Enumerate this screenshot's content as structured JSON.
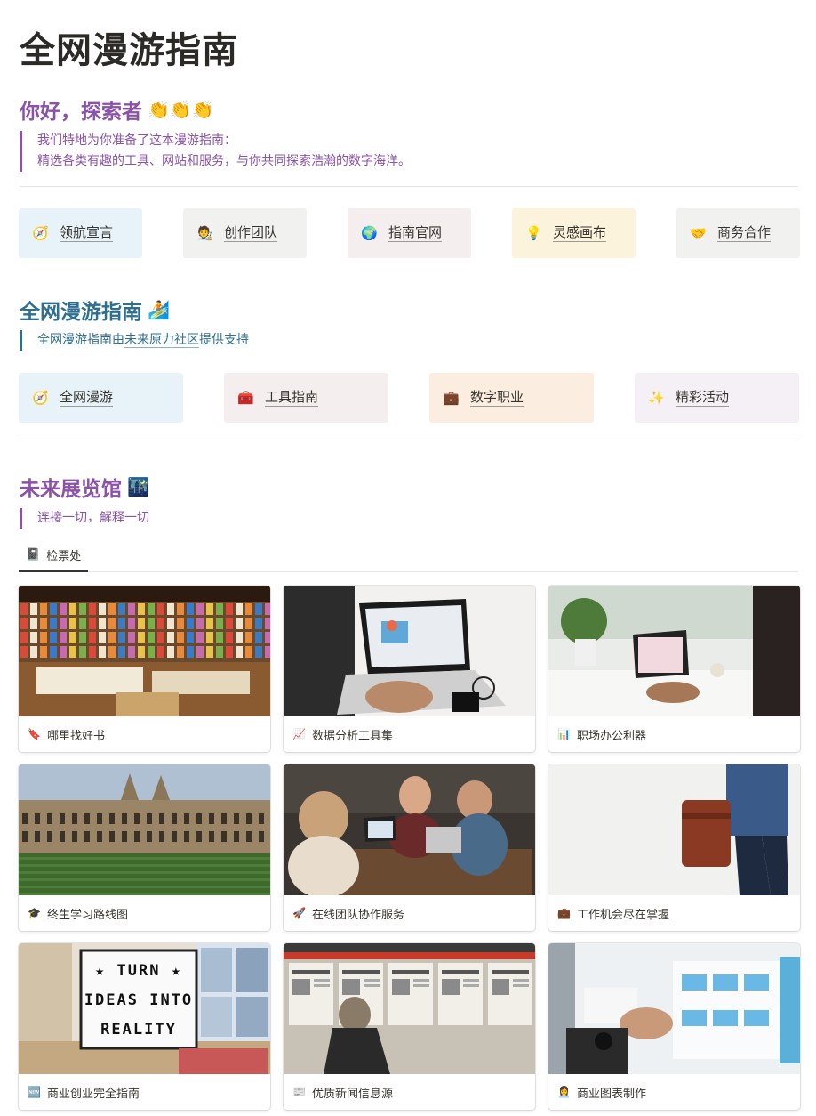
{
  "page": {
    "title": "全网漫游指南"
  },
  "intro": {
    "heading": "你好，探索者",
    "heading_emoji": "👏👏👏",
    "quote_line1": "我们特地为你准备了这本漫游指南：",
    "quote_line2": "精选各类有趣的工具、网站和服务，与你共同探索浩瀚的数字海洋。"
  },
  "nav_row1": [
    {
      "icon": "🧭",
      "label": "领航宣言",
      "bg": "bg-blue"
    },
    {
      "icon": "🧑‍🎨",
      "label": "创作团队",
      "bg": "bg-gray"
    },
    {
      "icon": "🌍",
      "label": "指南官网",
      "bg": "bg-pink"
    },
    {
      "icon": "💡",
      "label": "灵感画布",
      "bg": "bg-yellow"
    },
    {
      "icon": "🤝",
      "label": "商务合作",
      "bg": "bg-gray"
    }
  ],
  "section2": {
    "heading": "全网漫游指南",
    "heading_emoji": "🏄",
    "quote_pre": "全网漫游指南由",
    "quote_link": "未来原力社区",
    "quote_post": "提供支持"
  },
  "nav_row2": [
    {
      "icon": "🧭",
      "label": "全网漫游",
      "bg": "bg-blue"
    },
    {
      "icon": "🧰",
      "label": "工具指南",
      "bg": "bg-pink"
    },
    {
      "icon": "💼",
      "label": "数字职业",
      "bg": "bg-orange"
    },
    {
      "icon": "✨",
      "label": "精彩活动",
      "bg": "bg-purple"
    }
  ],
  "section3": {
    "heading": "未来展览馆",
    "heading_emoji": "🌃",
    "quote": "连接一切，解释一切"
  },
  "gallery_tab": {
    "icon": "📓",
    "label": "检票处"
  },
  "gallery": [
    {
      "icon": "🔖",
      "title": "哪里找好书",
      "cover": "bookstore"
    },
    {
      "icon": "📈",
      "title": "数据分析工具集",
      "cover": "laptop"
    },
    {
      "icon": "📊",
      "title": "职场办公利器",
      "cover": "office"
    },
    {
      "icon": "🎓",
      "title": "终生学习路线图",
      "cover": "college"
    },
    {
      "icon": "🚀",
      "title": "在线团队协作服务",
      "cover": "team"
    },
    {
      "icon": "💼",
      "title": "工作机会尽在掌握",
      "cover": "briefcase"
    },
    {
      "icon": "🆕",
      "title": "商业创业完全指南",
      "cover": "lightbox",
      "cover_text": [
        "★ TURN ★",
        "IDEAS INTO",
        "REALITY"
      ]
    },
    {
      "icon": "📰",
      "title": "优质新闻信息源",
      "cover": "news"
    },
    {
      "icon": "👩‍💼",
      "title": "商业图表制作",
      "cover": "chart"
    }
  ]
}
